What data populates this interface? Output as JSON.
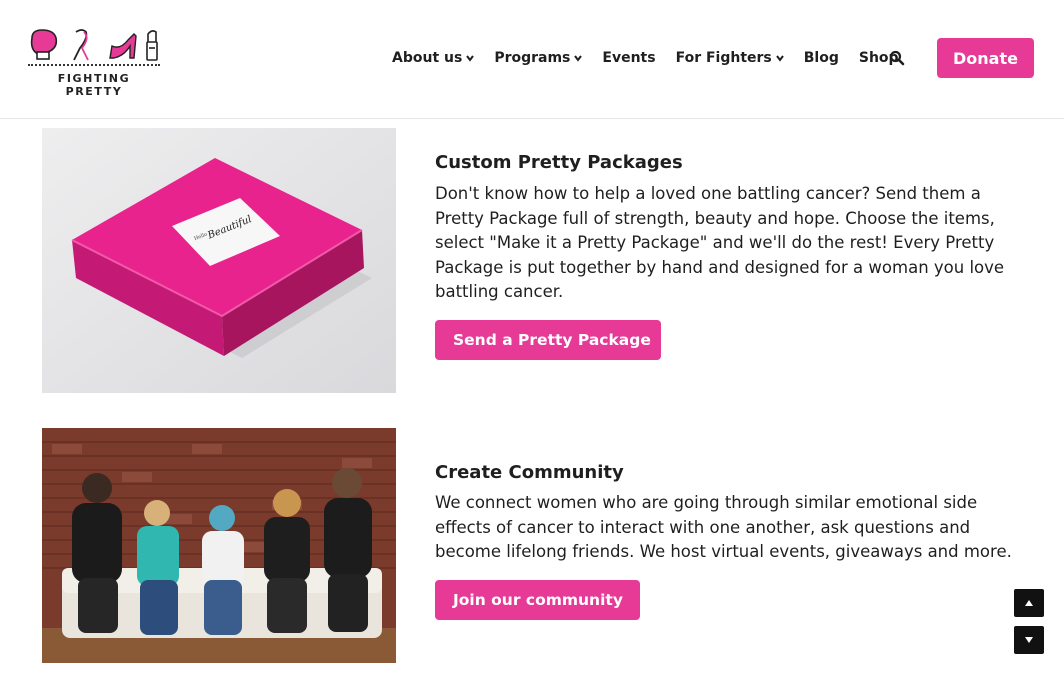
{
  "brand": {
    "logo_text": "FIGHTING PRETTY",
    "accent_color": "#e63a96"
  },
  "nav": {
    "items": [
      {
        "label": "About us",
        "has_dropdown": true
      },
      {
        "label": "Programs",
        "has_dropdown": true
      },
      {
        "label": "Events",
        "has_dropdown": false
      },
      {
        "label": "For Fighters",
        "has_dropdown": true
      },
      {
        "label": "Blog",
        "has_dropdown": false
      },
      {
        "label": "Shop",
        "has_dropdown": false
      }
    ],
    "search_icon": "search-icon",
    "donate_label": "Donate"
  },
  "sections": [
    {
      "title": "Custom Pretty Packages",
      "body": "Don't know how to help a loved one battling cancer? Send them a Pretty Package full of strength, beauty and hope. Choose the items, select \"Make it a Pretty Package\" and we'll do the rest! Every Pretty Package is put together by hand and designed for a woman you love battling cancer.",
      "button_label": "Send a Pretty Package",
      "image": {
        "box_label_small": "Hello",
        "box_label_script": "Beautiful"
      }
    },
    {
      "title": "Create Community",
      "body": "We connect women who are going through similar emotional side effects of cancer to interact with one another, ask questions and become lifelong friends. We host virtual events, giveaways and more.",
      "button_label": "Join our community"
    }
  ],
  "scroll": {
    "up_icon": "arrow-up-icon",
    "down_icon": "arrow-down-icon"
  }
}
